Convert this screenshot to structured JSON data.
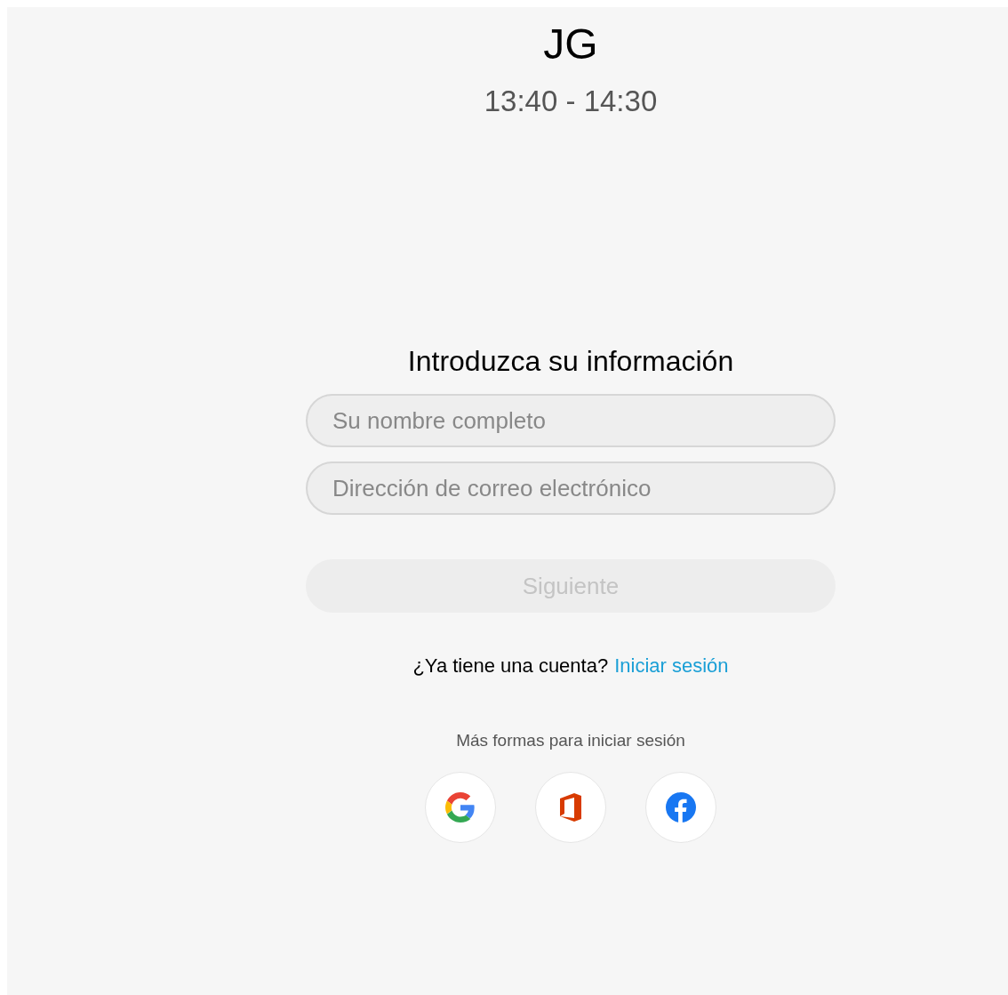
{
  "header": {
    "initials": "JG",
    "time": "13:40 - 14:30"
  },
  "form": {
    "title": "Introduzca su información",
    "fields": [
      {
        "placeholder": "Su nombre completo"
      },
      {
        "placeholder": "Dirección de correo electrónico"
      }
    ],
    "next_button": {
      "label": "Siguiente",
      "disabled": true
    },
    "account_prompt": "¿Ya tiene una cuenta?",
    "sign_in_link": "Iniciar sesión",
    "more_ways": "Más formas para iniciar sesión",
    "providers": [
      {
        "kind": "google"
      },
      {
        "kind": "office"
      },
      {
        "kind": "facebook"
      }
    ]
  }
}
